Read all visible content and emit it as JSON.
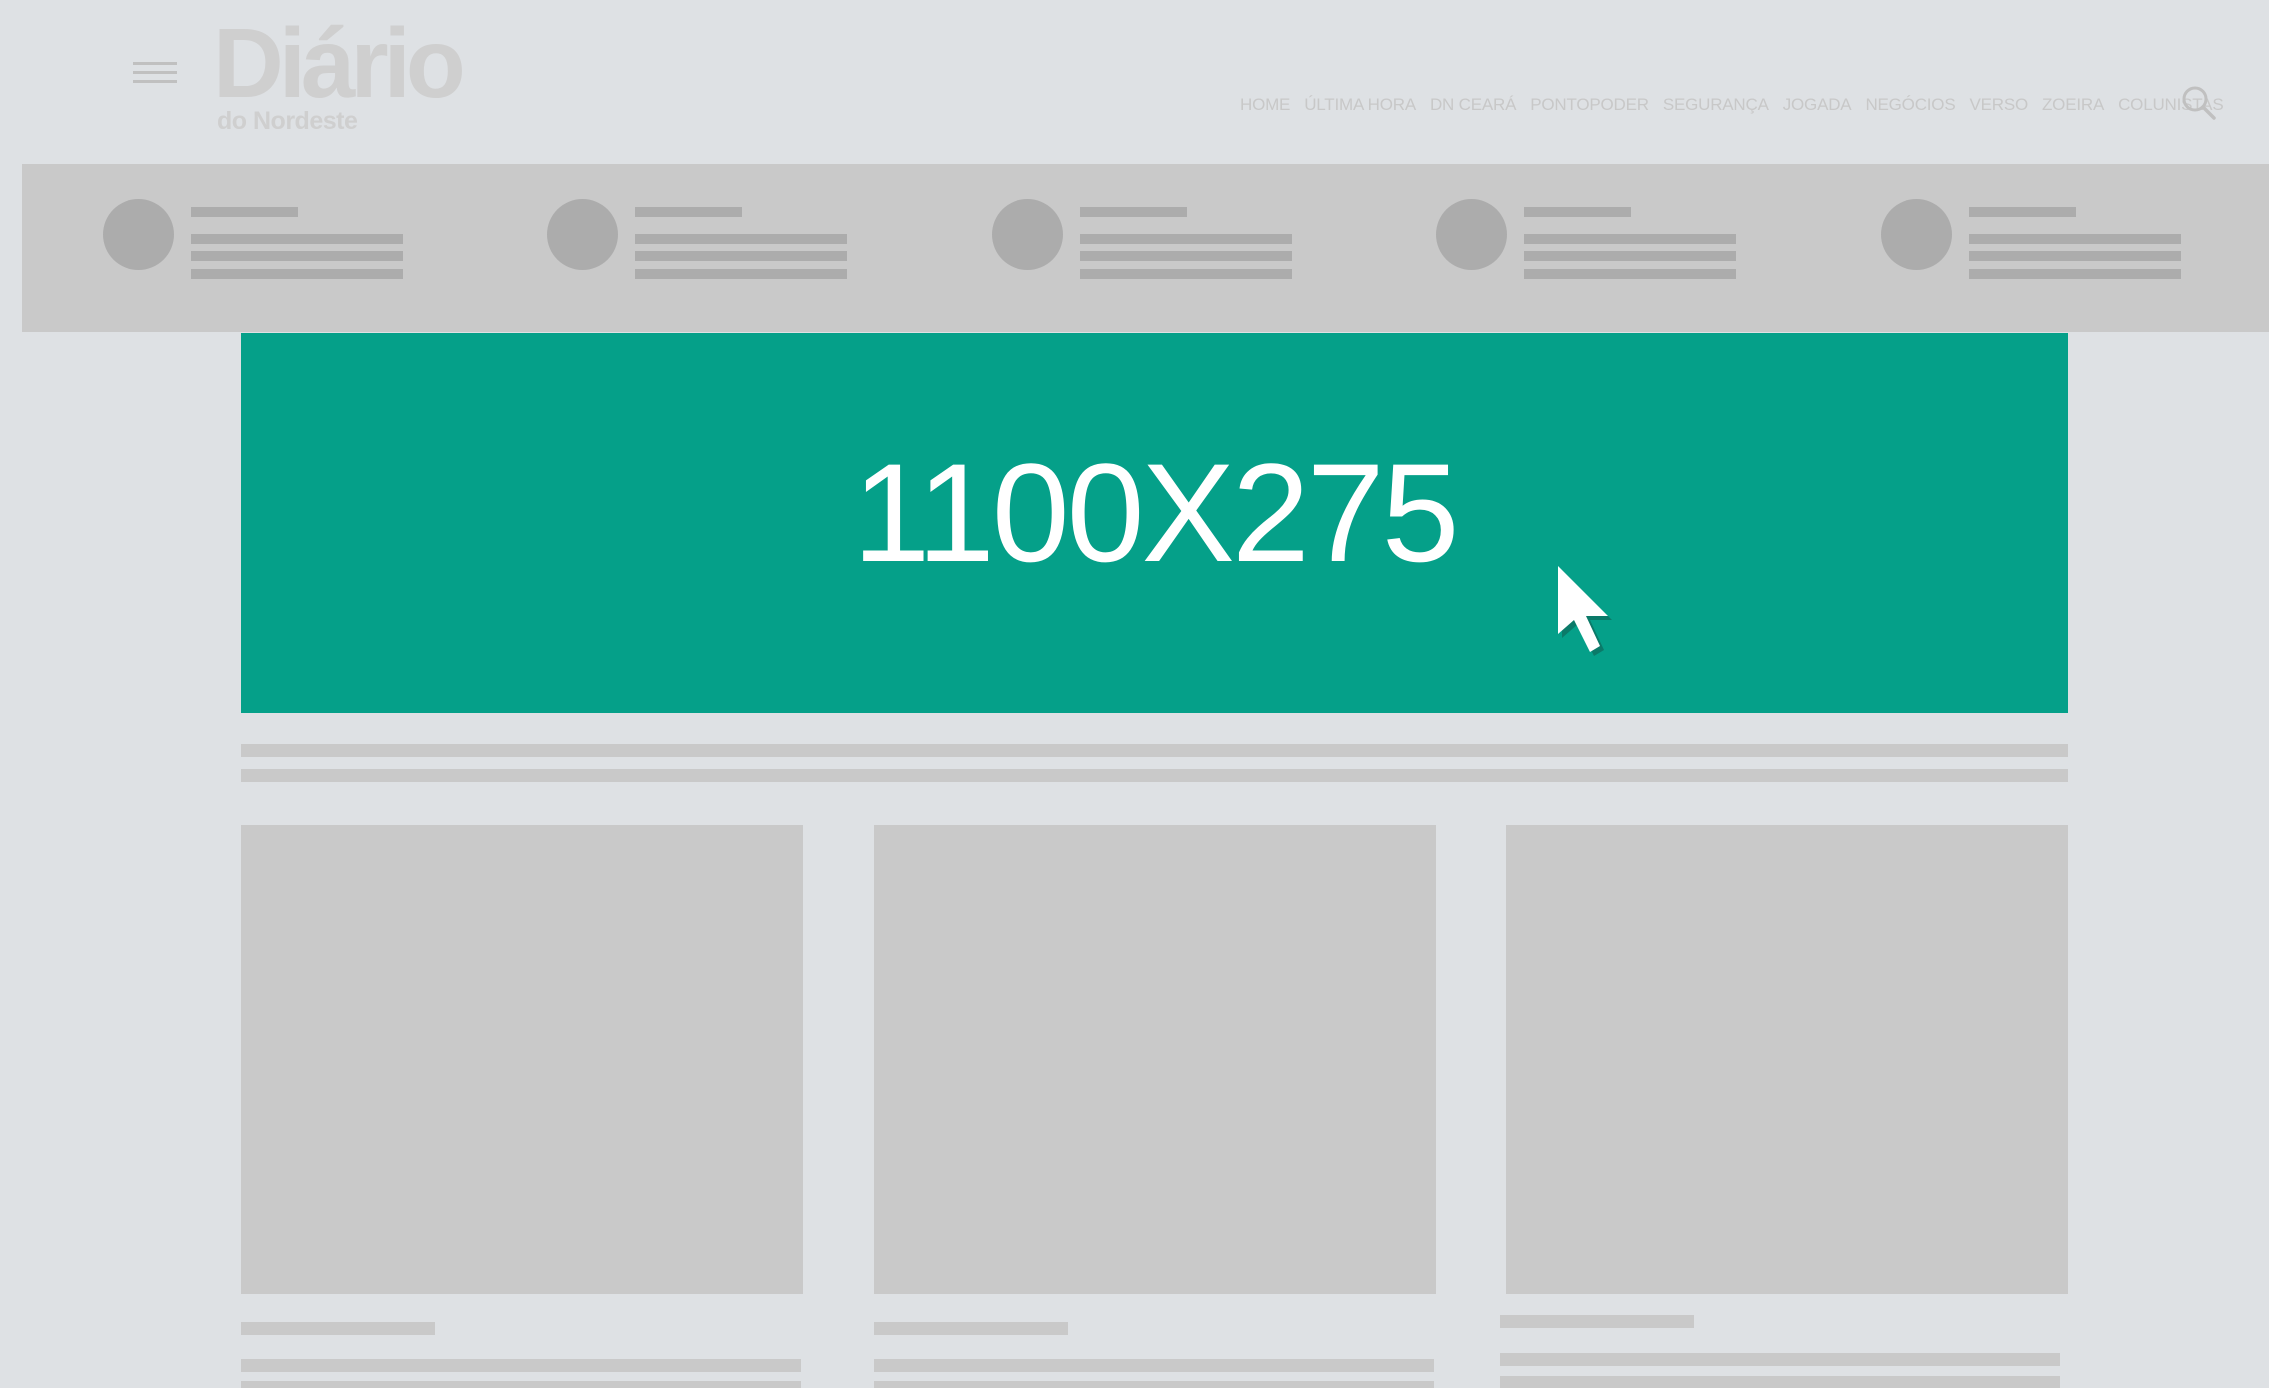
{
  "header": {
    "menu_icon": "hamburger-menu-icon",
    "logo": {
      "main": "Diário",
      "sub": "do Nordeste"
    },
    "nav": [
      "HOME",
      "ÚLTIMA HORA",
      "DN CEARÁ",
      "PONTOPODER",
      "SEGURANÇA",
      "JOGADA",
      "NEGÓCIOS",
      "VERSO",
      "ZOEIRA",
      "COLUNISTAS"
    ],
    "search_icon": "search-icon"
  },
  "banner": {
    "label": "1100X275",
    "color": "#05a089"
  },
  "colors": {
    "background": "#dee1e4",
    "placeholder": "#c9c9c9",
    "placeholder_dark": "#acacac",
    "logo": "#cfcfcf"
  }
}
